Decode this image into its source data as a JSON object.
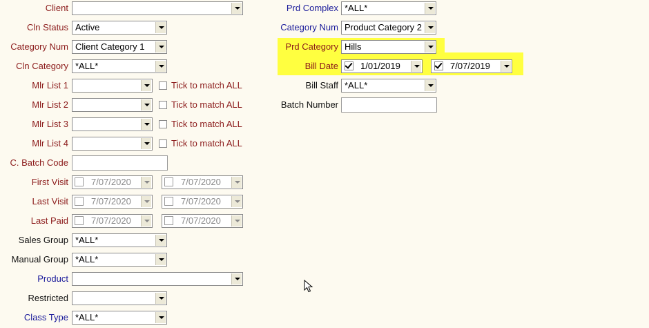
{
  "left": {
    "client": {
      "label": "Client",
      "value": ""
    },
    "cln_status": {
      "label": "Cln Status",
      "value": "Active"
    },
    "category_num": {
      "label": "Category Num",
      "value": "Client Category 1"
    },
    "cln_category": {
      "label": "Cln Category",
      "value": "*ALL*"
    },
    "mlr_lists": [
      {
        "label": "Mlr List 1",
        "value": "",
        "tick_label": "Tick to match ALL"
      },
      {
        "label": "Mlr List 2",
        "value": "",
        "tick_label": "Tick to match ALL"
      },
      {
        "label": "Mlr List 3",
        "value": "",
        "tick_label": "Tick to match ALL"
      },
      {
        "label": "Mlr List 4",
        "value": "",
        "tick_label": "Tick to match ALL"
      }
    ],
    "c_batch_code": {
      "label": "C. Batch Code",
      "value": ""
    },
    "first_visit": {
      "label": "First Visit",
      "from": "7/07/2020",
      "to": "7/07/2020"
    },
    "last_visit": {
      "label": "Last Visit",
      "from": "7/07/2020",
      "to": "7/07/2020"
    },
    "last_paid": {
      "label": "Last Paid",
      "from": "7/07/2020",
      "to": "7/07/2020"
    },
    "sales_group": {
      "label": "Sales Group",
      "value": "*ALL*"
    },
    "manual_group": {
      "label": "Manual Group",
      "value": "*ALL*"
    },
    "product": {
      "label": "Product",
      "value": ""
    },
    "restricted": {
      "label": "Restricted",
      "value": ""
    },
    "class_type": {
      "label": "Class Type",
      "value": "*ALL*"
    }
  },
  "right": {
    "prd_complex": {
      "label": "Prd Complex",
      "value": "*ALL*"
    },
    "category_num": {
      "label": "Category Num",
      "value": "Product Category 2"
    },
    "prd_category": {
      "label": "Prd Category",
      "value": "Hills"
    },
    "bill_date": {
      "label": "Bill Date",
      "from": "1/01/2019",
      "to": "7/07/2019"
    },
    "bill_staff": {
      "label": "Bill Staff",
      "value": "*ALL*"
    },
    "batch_number": {
      "label": "Batch Number",
      "value": ""
    }
  },
  "colors": {
    "background": "#fdfaf0",
    "label_red": "#8b1a1a",
    "label_blue": "#1a1a9a",
    "highlight": "#ffff40"
  },
  "icons": {
    "dropdown": "chevron-down-icon",
    "checkbox": "checkbox",
    "cursor": "mouse-pointer-icon"
  }
}
